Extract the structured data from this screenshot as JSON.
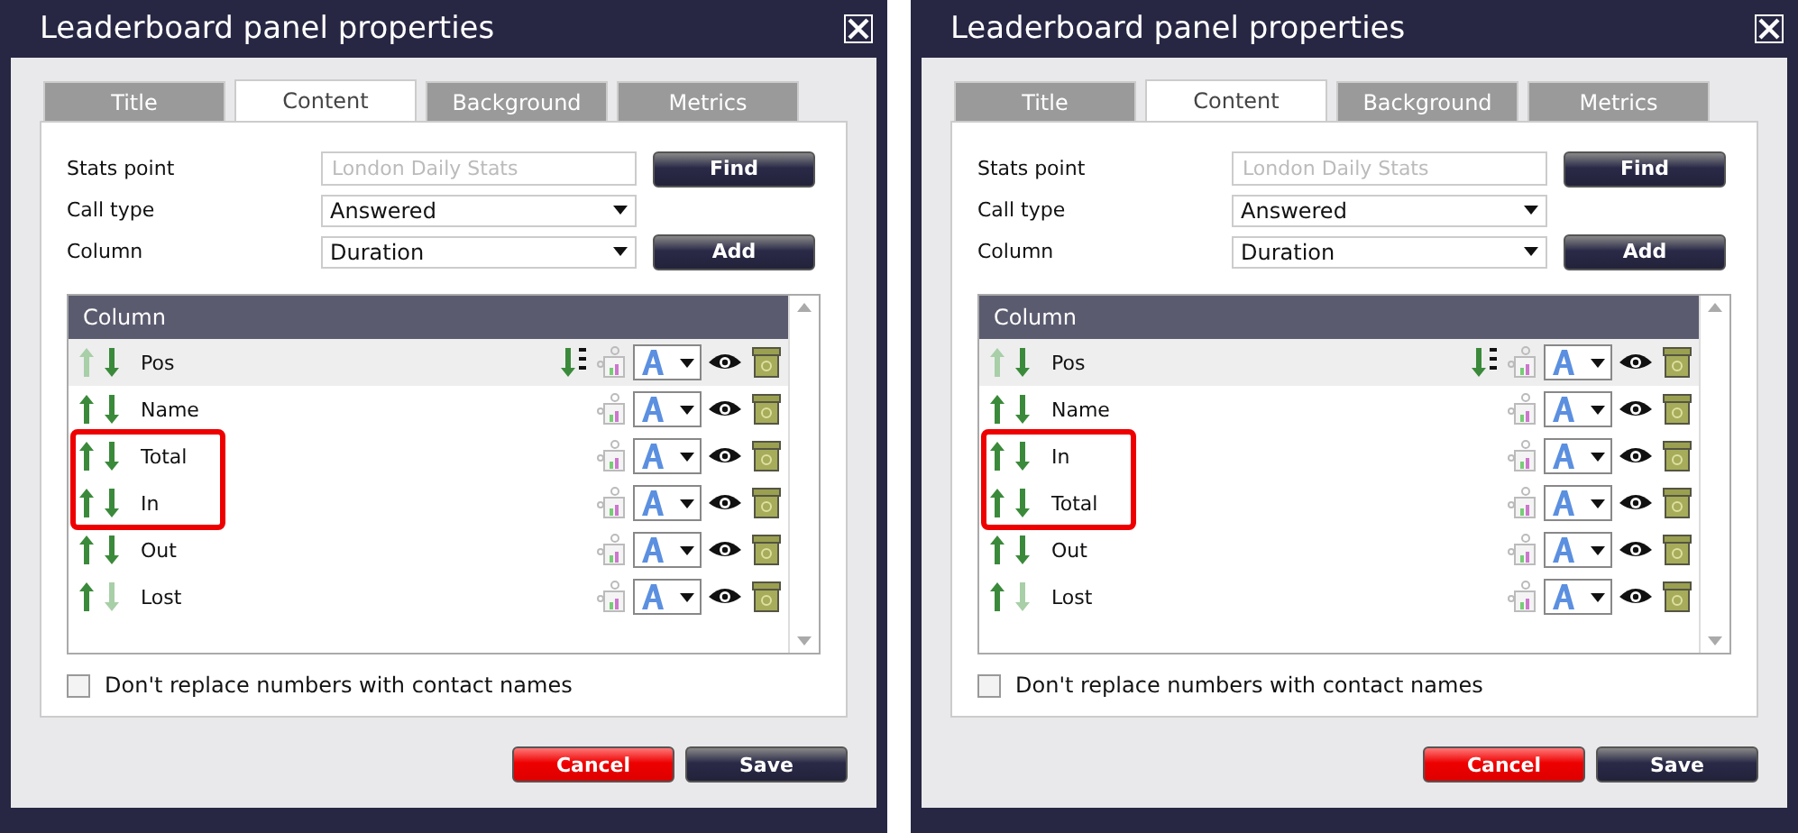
{
  "dialogs": [
    {
      "title": "Leaderboard panel properties",
      "tabs": [
        {
          "label": "Title",
          "selected": false
        },
        {
          "label": "Content",
          "selected": true
        },
        {
          "label": "Background",
          "selected": false
        },
        {
          "label": "Metrics",
          "selected": false
        }
      ],
      "fields": [
        {
          "label": "Stats point",
          "kind": "text",
          "placeholder": "London Daily Stats",
          "button": "Find"
        },
        {
          "label": "Call type",
          "kind": "select",
          "value": "Answered"
        },
        {
          "label": "Column",
          "kind": "select",
          "value": "Duration",
          "button": "Add"
        }
      ],
      "list_header": "Column",
      "rows": [
        {
          "name": "Pos",
          "selected": true,
          "up_enabled": false,
          "down_enabled": true,
          "sorted": true,
          "highlighted": false
        },
        {
          "name": "Name",
          "selected": false,
          "up_enabled": true,
          "down_enabled": true,
          "sorted": false,
          "highlighted": false
        },
        {
          "name": "Total",
          "selected": false,
          "up_enabled": true,
          "down_enabled": true,
          "sorted": false,
          "highlighted": true
        },
        {
          "name": "In",
          "selected": false,
          "up_enabled": true,
          "down_enabled": true,
          "sorted": false,
          "highlighted": true
        },
        {
          "name": "Out",
          "selected": false,
          "up_enabled": true,
          "down_enabled": true,
          "sorted": false,
          "highlighted": false
        },
        {
          "name": "Lost",
          "selected": false,
          "up_enabled": true,
          "down_enabled": false,
          "sorted": false,
          "highlighted": false
        }
      ],
      "checkbox": {
        "label": "Don't replace numbers with contact names",
        "checked": false
      },
      "buttons": [
        {
          "label": "Cancel",
          "kind": "danger"
        },
        {
          "label": "Save",
          "kind": "primary"
        }
      ]
    },
    {
      "title": "Leaderboard panel properties",
      "tabs": [
        {
          "label": "Title",
          "selected": false
        },
        {
          "label": "Content",
          "selected": true
        },
        {
          "label": "Background",
          "selected": false
        },
        {
          "label": "Metrics",
          "selected": false
        }
      ],
      "fields": [
        {
          "label": "Stats point",
          "kind": "text",
          "placeholder": "London Daily Stats",
          "button": "Find"
        },
        {
          "label": "Call type",
          "kind": "select",
          "value": "Answered"
        },
        {
          "label": "Column",
          "kind": "select",
          "value": "Duration",
          "button": "Add"
        }
      ],
      "list_header": "Column",
      "rows": [
        {
          "name": "Pos",
          "selected": true,
          "up_enabled": false,
          "down_enabled": true,
          "sorted": true,
          "highlighted": false
        },
        {
          "name": "Name",
          "selected": false,
          "up_enabled": true,
          "down_enabled": true,
          "sorted": false,
          "highlighted": false
        },
        {
          "name": "In",
          "selected": false,
          "up_enabled": true,
          "down_enabled": true,
          "sorted": false,
          "highlighted": true
        },
        {
          "name": "Total",
          "selected": false,
          "up_enabled": true,
          "down_enabled": true,
          "sorted": false,
          "highlighted": true
        },
        {
          "name": "Out",
          "selected": false,
          "up_enabled": true,
          "down_enabled": true,
          "sorted": false,
          "highlighted": false
        },
        {
          "name": "Lost",
          "selected": false,
          "up_enabled": true,
          "down_enabled": false,
          "sorted": false,
          "highlighted": false
        }
      ],
      "checkbox": {
        "label": "Don't replace numbers with contact names",
        "checked": false
      },
      "buttons": [
        {
          "label": "Cancel",
          "kind": "danger"
        },
        {
          "label": "Save",
          "kind": "primary"
        }
      ]
    }
  ]
}
